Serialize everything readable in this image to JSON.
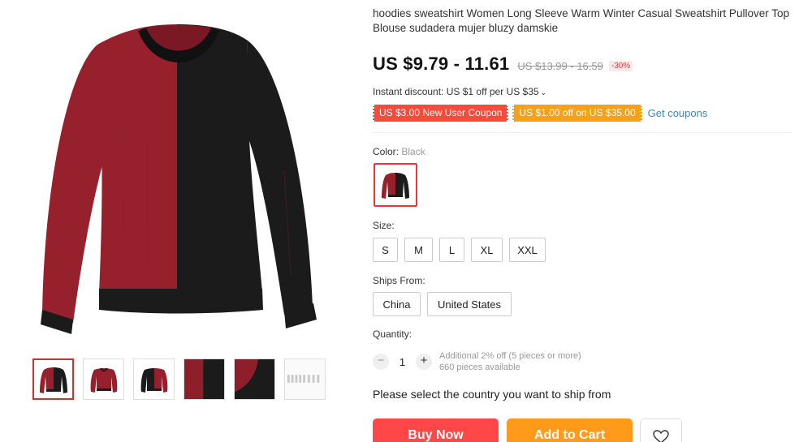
{
  "product": {
    "title": "hoodies sweatshirt Women Long Sleeve Warm Winter Casual Sweatshirt Pullover Top Blouse sudadera mujer bluzy damskie",
    "price": "US $9.79 - 11.61",
    "original_price": "US $13.99 - 16.59",
    "discount": "-30%"
  },
  "promo": {
    "instant_discount": "Instant discount: US $1 off per US $35",
    "coupons": [
      "US $3.00 New User Coupon",
      "US $1.00 off on US $35.00"
    ],
    "get_coupons": "Get coupons"
  },
  "gallery": {
    "thumbnail_count": 6,
    "active_index": 0,
    "colors": {
      "red": "#96202c",
      "black": "#1b1b1b"
    }
  },
  "options": {
    "color": {
      "label": "Color:",
      "selected": "Black"
    },
    "size": {
      "label": "Size:",
      "values": [
        "S",
        "M",
        "L",
        "XL",
        "XXL"
      ]
    },
    "ships_from": {
      "label": "Ships From:",
      "values": [
        "China",
        "United States"
      ]
    }
  },
  "quantity": {
    "label": "Quantity:",
    "value": "1",
    "decrement": "−",
    "increment": "+",
    "note_line1": "Additional 2% off (5 pieces or more)",
    "note_line2": "660 pieces available"
  },
  "shipping_message": "Please select the country you want to ship from",
  "actions": {
    "buy_now": "Buy Now",
    "add_to_cart": "Add to Cart"
  },
  "icons": {
    "heart": "heart-icon",
    "chevron": "chevron-down-icon"
  },
  "accent_colors": {
    "red": "#ff4747",
    "orange": "#ff9a1b",
    "link": "#2e8bd5"
  }
}
